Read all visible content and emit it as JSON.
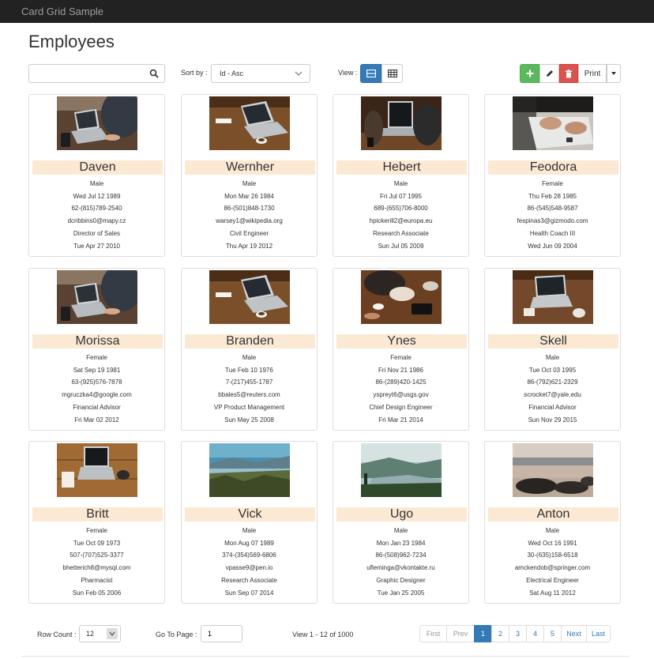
{
  "navbar": {
    "brand": "Card Grid Sample"
  },
  "page": {
    "title": "Employees"
  },
  "toolbar": {
    "search_value": "",
    "search_icon": "search-icon",
    "sort_label": "Sort by :",
    "sort_value": "Id - Asc",
    "view_label": "View :",
    "view_modes": [
      "card-view-icon",
      "table-view-icon"
    ],
    "active_view": "card",
    "add_icon": "plus-icon",
    "edit_icon": "pencil-icon",
    "delete_icon": "trash-icon",
    "print_label": "Print"
  },
  "cards": [
    {
      "name": "Daven",
      "gender": "Male",
      "dob": "Wed Jul 12 1989",
      "phone": "62-(815)789-2540",
      "email": "dcribbins0@mapy.cz",
      "title": "Director of Sales",
      "hired": "Tue Apr 27 2010",
      "photo": "laptop-desk-photo"
    },
    {
      "name": "Wernher",
      "gender": "Male",
      "dob": "Mon Mar 26 1984",
      "phone": "86-(501)848-1730",
      "email": "warsey1@wikipedia.org",
      "title": "Civil Engineer",
      "hired": "Thu Apr 19 2012",
      "photo": "laptop-wood-table-photo"
    },
    {
      "name": "Hebert",
      "gender": "Male",
      "dob": "Fri Jul 07 1995",
      "phone": "689-(655)706-8000",
      "email": "hpickerill2@europa.eu",
      "title": "Research Associate",
      "hired": "Sun Jul 05 2009",
      "photo": "person-laptop-phone-photo"
    },
    {
      "name": "Feodora",
      "gender": "Female",
      "dob": "Thu Feb 28 1985",
      "phone": "86-(545)548-9587",
      "email": "fespinas3@gizmodo.com",
      "title": "Health Coach III",
      "hired": "Wed Jun 09 2004",
      "photo": "hands-typing-photo"
    },
    {
      "name": "Morissa",
      "gender": "Female",
      "dob": "Sat Sep 19 1981",
      "phone": "63-(925)576-7878",
      "email": "mgruczka4@google.com",
      "title": "Financial Advisor",
      "hired": "Fri Mar 02 2012",
      "photo": "laptop-desk-photo"
    },
    {
      "name": "Branden",
      "gender": "Male",
      "dob": "Tue Feb 10 1976",
      "phone": "7-(217)455-1787",
      "email": "bbales5@reuters.com",
      "title": "VP Product Management",
      "hired": "Sun May 25 2008",
      "photo": "laptop-wood-table-photo"
    },
    {
      "name": "Ynes",
      "gender": "Female",
      "dob": "Fri Nov 21 1986",
      "phone": "86-(289)420-1425",
      "email": "yspreyt6@usgs.gov",
      "title": "Chief Design Engineer",
      "hired": "Fri Mar 21 2014",
      "photo": "coffee-tablet-photo"
    },
    {
      "name": "Skell",
      "gender": "Male",
      "dob": "Tue Oct 03 1995",
      "phone": "86-(792)621-2329",
      "email": "scrocket7@yale.edu",
      "title": "Financial Advisor",
      "hired": "Sun Nov 29 2015",
      "photo": "laptop-coffee-photo"
    },
    {
      "name": "Britt",
      "gender": "Female",
      "dob": "Tue Oct 09 1973",
      "phone": "507-(707)525-3377",
      "email": "bhetterich8@mysql.com",
      "title": "Pharmacist",
      "hired": "Sun Feb 05 2006",
      "photo": "laptop-floor-photo"
    },
    {
      "name": "Vick",
      "gender": "Male",
      "dob": "Mon Aug 07 1989",
      "phone": "374-(354)569-6806",
      "email": "vpasse9@pen.io",
      "title": "Research Associate",
      "hired": "Sun Sep 07 2014",
      "photo": "lake-landscape-photo"
    },
    {
      "name": "Ugo",
      "gender": "Male",
      "dob": "Mon Jan 23 1984",
      "phone": "86-(508)962-7234",
      "email": "ufleminga@vkontakte.ru",
      "title": "Graphic Designer",
      "hired": "Tue Jan 25 2005",
      "photo": "misty-river-photo"
    },
    {
      "name": "Anton",
      "gender": "Male",
      "dob": "Wed Oct 16 1991",
      "phone": "30-(635)158-6518",
      "email": "amckendob@springer.com",
      "title": "Electrical Engineer",
      "hired": "Sat Aug 11 2012",
      "photo": "beach-rocks-photo"
    }
  ],
  "footer": {
    "row_count_label": "Row Count :",
    "row_count_value": "12",
    "goto_label": "Go To Page :",
    "goto_value": "1",
    "view_info": "View 1 - 12 of 1000",
    "pager": [
      {
        "label": "First",
        "state": "disabled"
      },
      {
        "label": "Prev",
        "state": "disabled"
      },
      {
        "label": "1",
        "state": "active"
      },
      {
        "label": "2",
        "state": "normal"
      },
      {
        "label": "3",
        "state": "normal"
      },
      {
        "label": "4",
        "state": "normal"
      },
      {
        "label": "5",
        "state": "normal"
      },
      {
        "label": "Next",
        "state": "normal"
      },
      {
        "label": "Last",
        "state": "normal"
      }
    ]
  }
}
